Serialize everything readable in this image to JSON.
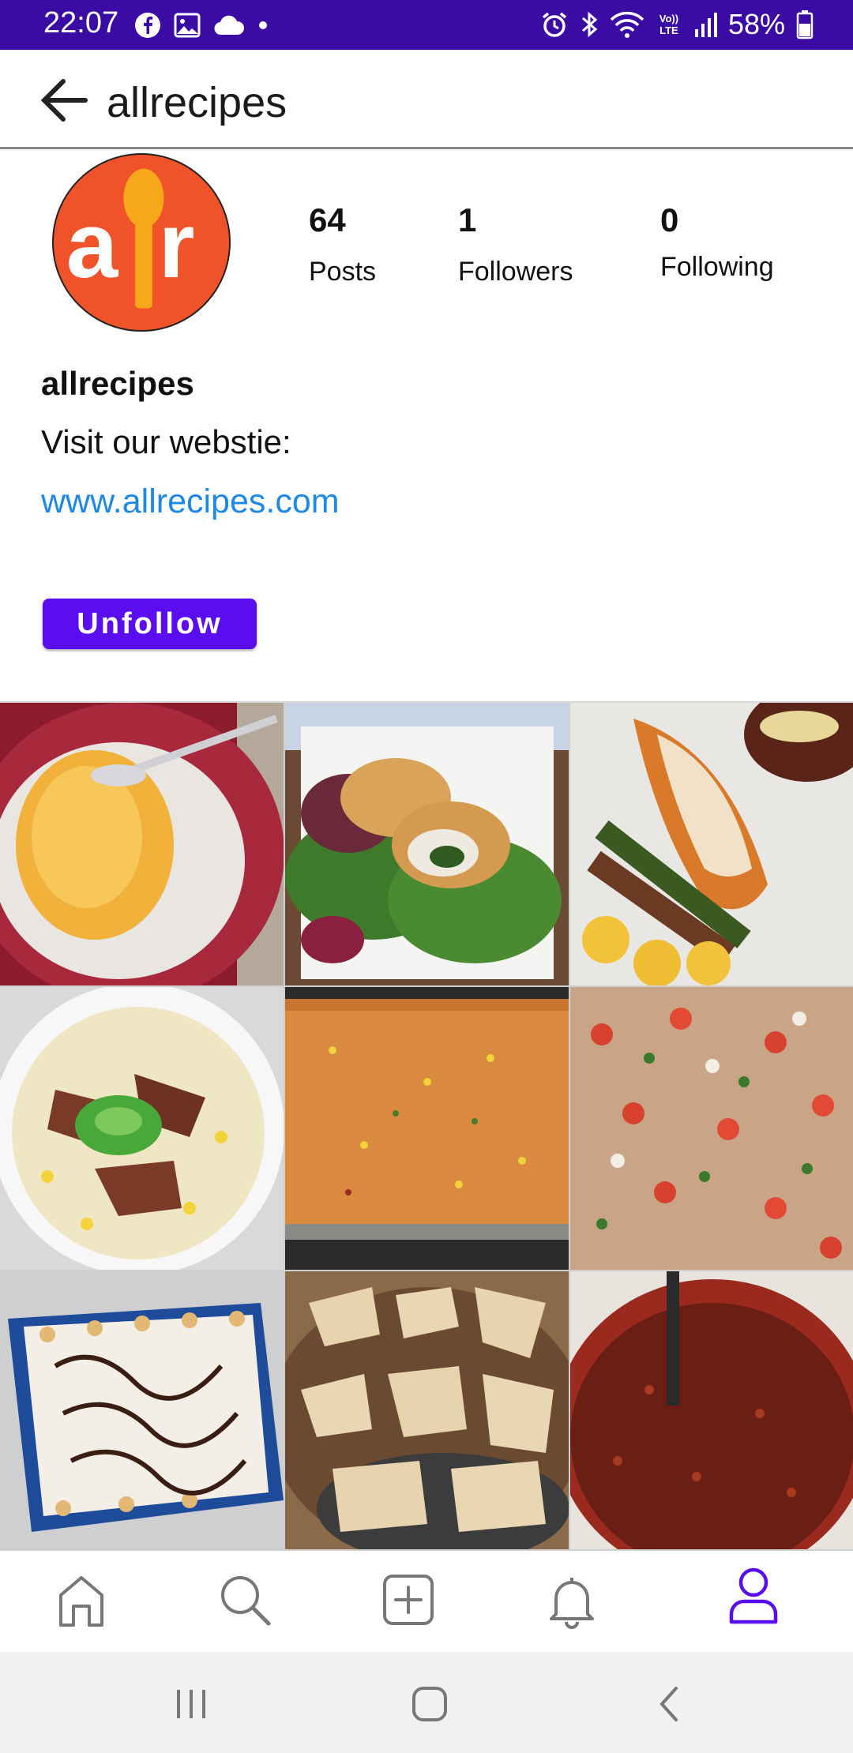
{
  "status_bar": {
    "time": "22:07",
    "left_icons": [
      "facebook-icon",
      "gallery-icon",
      "cloud-icon",
      "dot-icon"
    ],
    "right_icons": [
      "alarm-icon",
      "bluetooth-icon",
      "wifi-icon",
      "volte-icon",
      "signal-icon",
      "battery-icon"
    ],
    "volte_text": "Vo)) LTE",
    "battery": "58%",
    "color": "#3a0ca3"
  },
  "app_bar": {
    "back_icon": "arrow-back-icon",
    "title": "allrecipes"
  },
  "profile": {
    "avatar_letters": "ar",
    "avatar_color": "#f0522a",
    "stats": [
      {
        "count": "64",
        "label": "Posts"
      },
      {
        "count": "1",
        "label": "Followers"
      },
      {
        "count": "0",
        "label": "Following"
      }
    ],
    "name": "allrecipes",
    "bio": "Visit our webstie:",
    "website": "www.allrecipes.com",
    "unfollow_label": "Unfollow",
    "button_color": "#5a0ef0",
    "link_color": "#1e88e5"
  },
  "posts": [
    {
      "name": "post-cheese-grits"
    },
    {
      "name": "post-stuffed-chicken-salad"
    },
    {
      "name": "post-lobster-steak"
    },
    {
      "name": "post-corn-chowder"
    },
    {
      "name": "post-spanish-rice"
    },
    {
      "name": "post-shrimp-ceviche"
    },
    {
      "name": "post-banana-pudding"
    },
    {
      "name": "post-cream-cheese-wontons"
    },
    {
      "name": "post-baked-beans"
    }
  ],
  "bottom_nav": {
    "items": [
      "home-icon",
      "search-icon",
      "add-post-icon",
      "notifications-icon",
      "profile-icon"
    ],
    "active": "profile-icon",
    "active_color": "#5a0ef0"
  },
  "system_nav": {
    "items": [
      "recents-button",
      "home-button",
      "back-button"
    ]
  }
}
